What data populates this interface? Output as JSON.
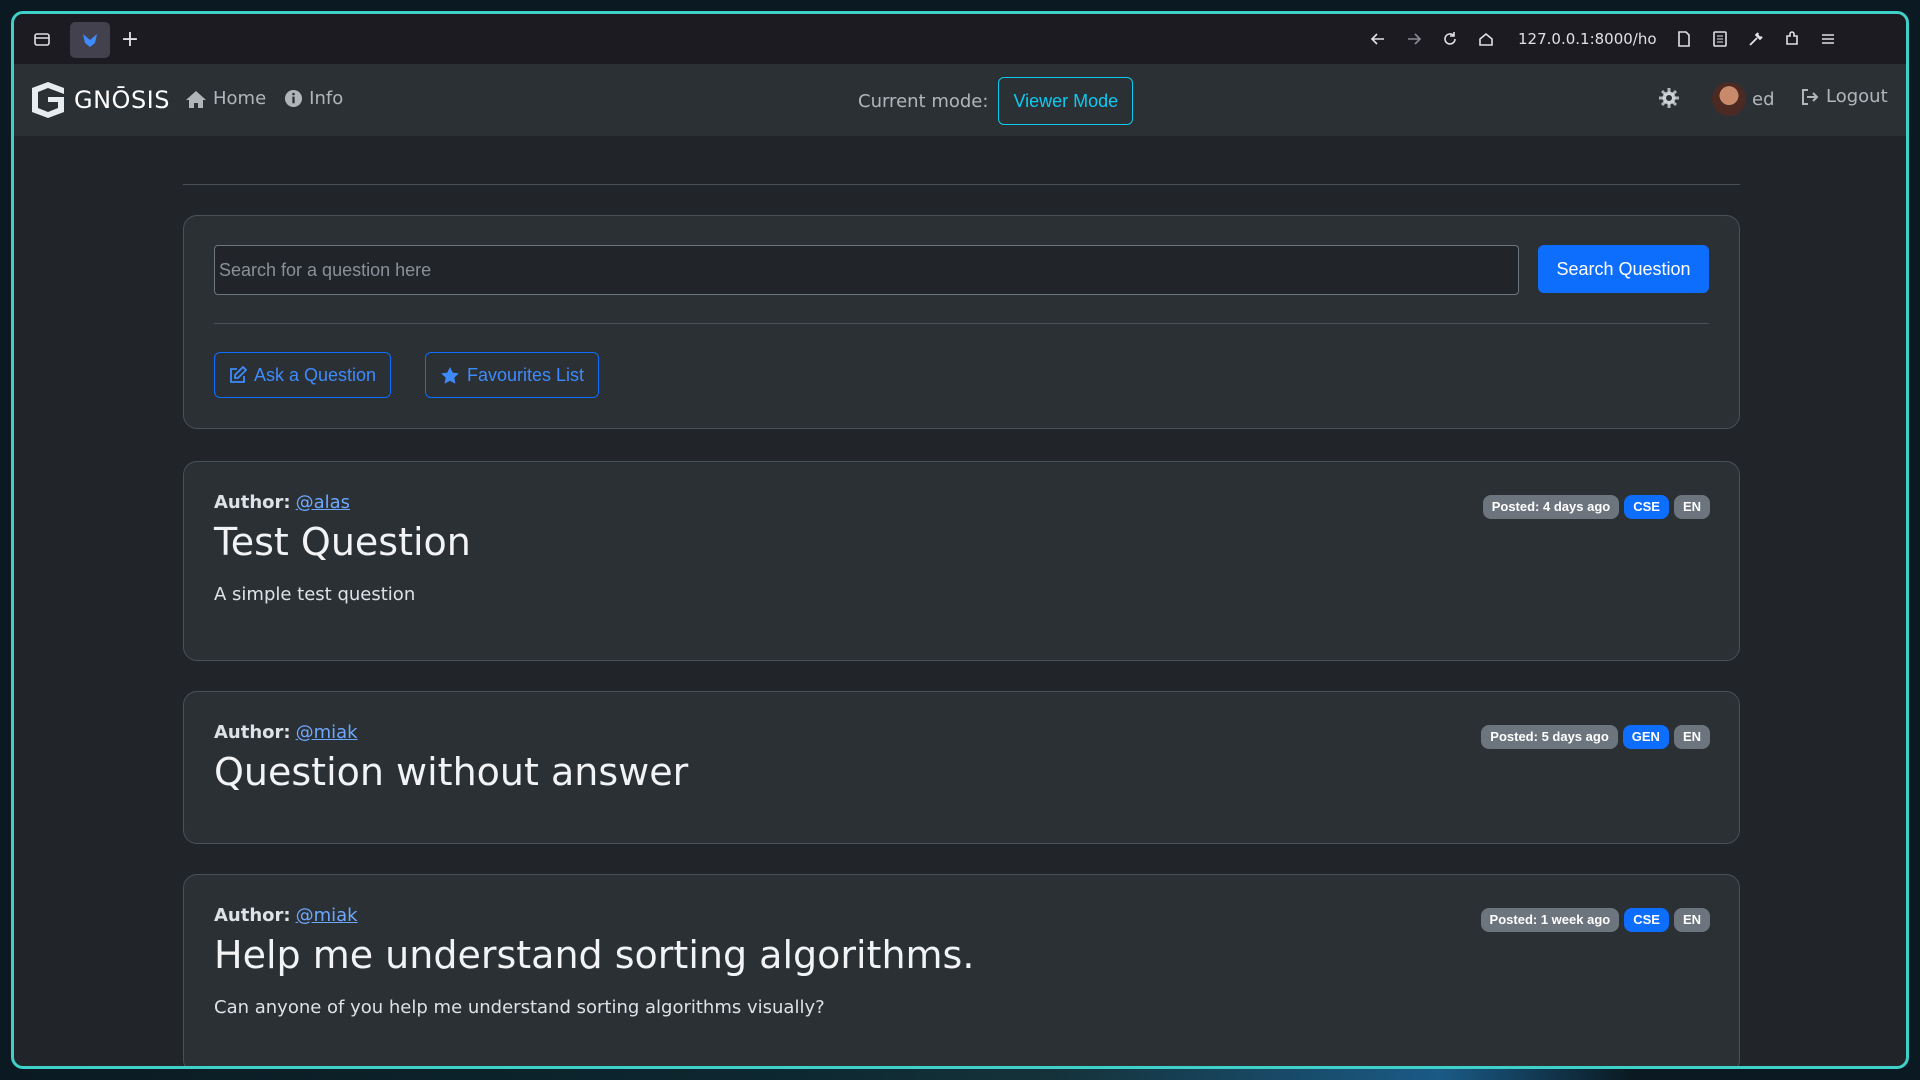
{
  "browser": {
    "url": "127.0.0.1:8000/ho"
  },
  "navbar": {
    "brand": "GNŌSIS",
    "links": [
      {
        "label": "Home",
        "icon": "home-icon"
      },
      {
        "label": "Info",
        "icon": "info-icon"
      }
    ],
    "mode_label": "Current mode:",
    "mode_value": "Viewer Mode",
    "user": "ed",
    "logout": "Logout"
  },
  "search": {
    "placeholder": "Search for a question here",
    "button": "Search Question",
    "ask_button": "Ask a Question",
    "favourites_button": "Favourites List"
  },
  "questions": [
    {
      "author_label": "Author:",
      "author": "@alas",
      "title": "Test Question",
      "description": "A simple test question",
      "posted": "Posted: 4 days ago",
      "category": "CSE",
      "language": "EN"
    },
    {
      "author_label": "Author:",
      "author": "@miak",
      "title": "Question without answer",
      "description": "",
      "posted": "Posted: 5 days ago",
      "category": "GEN",
      "language": "EN"
    },
    {
      "author_label": "Author:",
      "author": "@miak",
      "title": "Help me understand sorting algorithms.",
      "description": "Can anyone of you help me understand sorting algorithms visually?",
      "posted": "Posted: 1 week ago",
      "category": "CSE",
      "language": "EN"
    }
  ],
  "colors": {
    "primary": "#0d6efd",
    "info": "#0dcaf0",
    "body_bg": "#212529",
    "card_bg": "#2b3035",
    "window_border": "#3fd0c9"
  }
}
